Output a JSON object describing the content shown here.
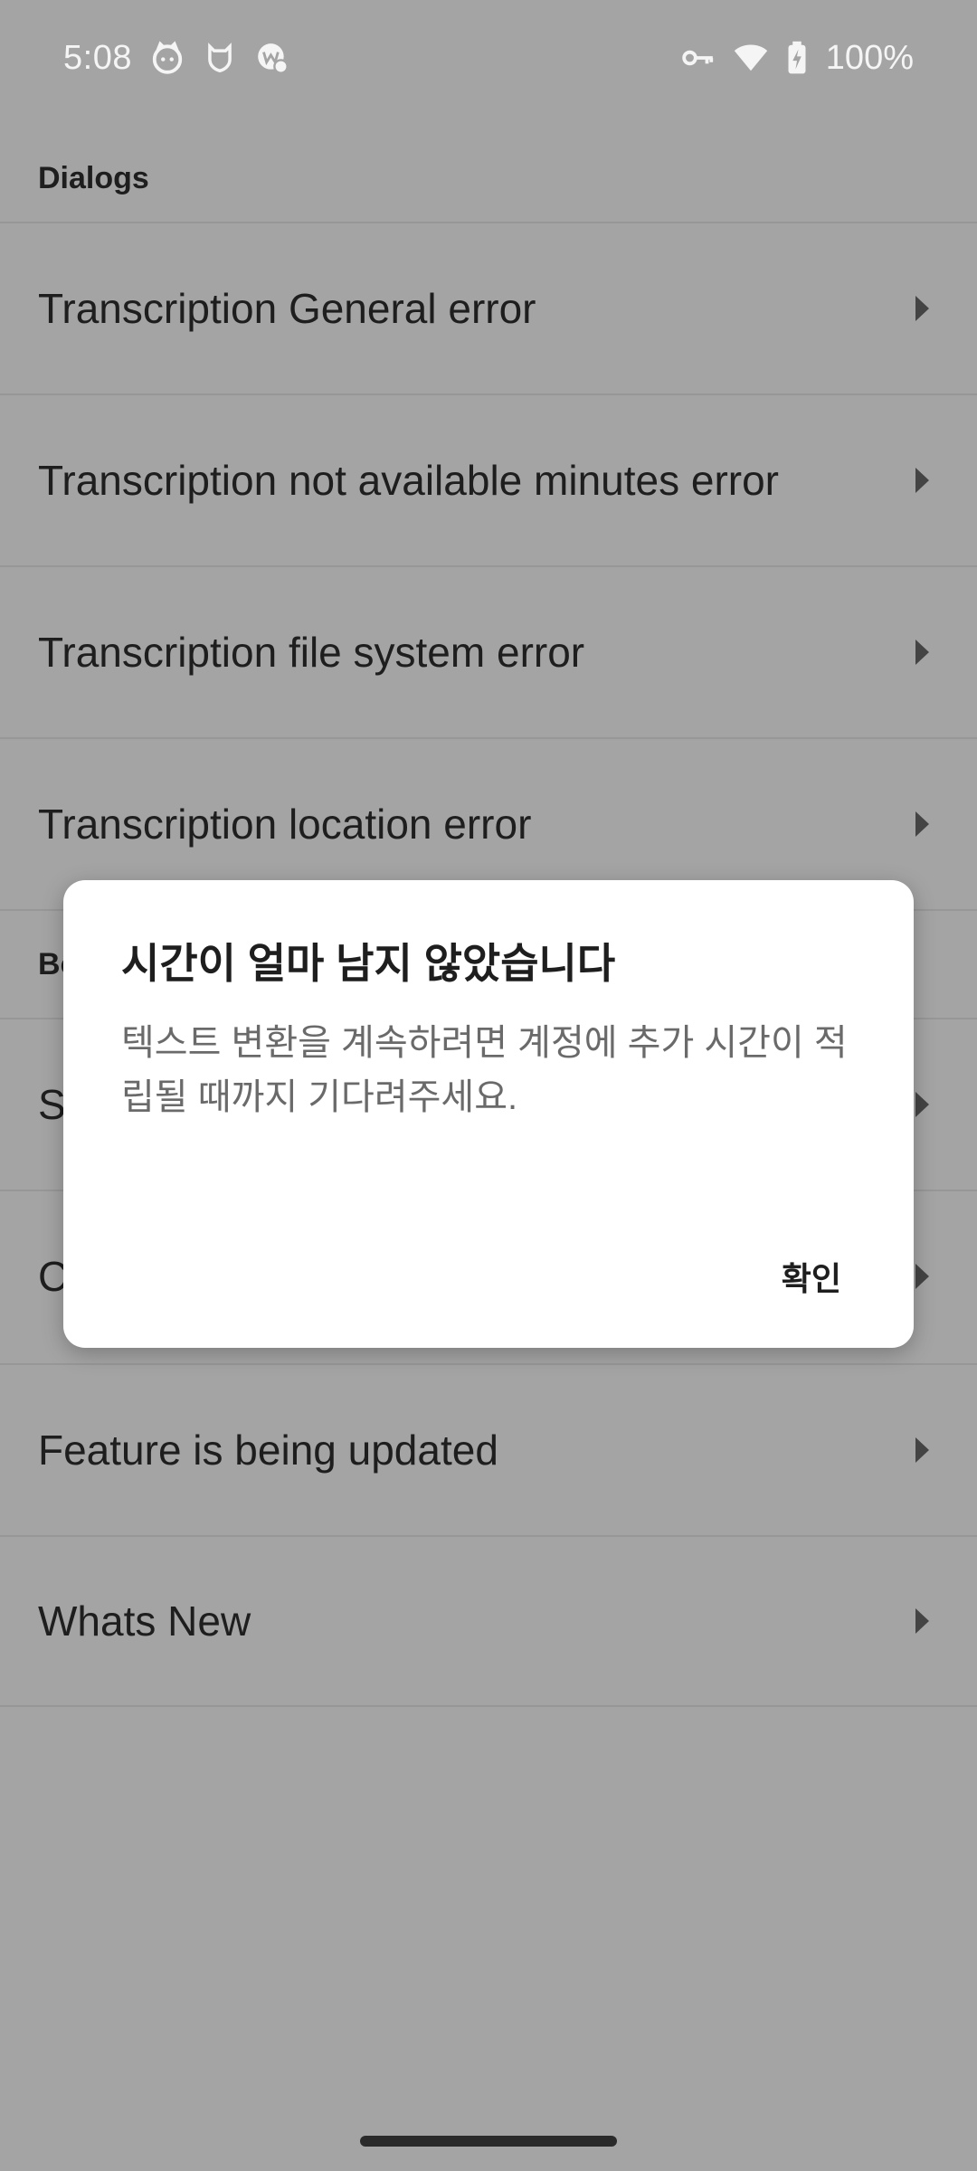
{
  "status_bar": {
    "time": "5:08",
    "battery_text": "100%",
    "left_icons": [
      "cat-face-icon",
      "shield-cat-icon",
      "app-badge-icon"
    ],
    "right_icons": [
      "vpn-key-icon",
      "wifi-icon",
      "battery-charging-icon"
    ]
  },
  "sections": {
    "dialogs_header": "Dialogs",
    "second_header_partial": "Bo"
  },
  "list": {
    "items": [
      "Transcription General error",
      "Transcription not available minutes error",
      "Transcription file system error",
      "Transcription location error",
      "S",
      "C",
      "Feature is being updated",
      "Whats New"
    ]
  },
  "dialog": {
    "title": "시간이 얼마 남지 않았습니다",
    "body": "텍스트 변환을 계속하려면 계정에 추가 시간이 적립될 때까지 기다려주세요.",
    "confirm_label": "확인"
  }
}
